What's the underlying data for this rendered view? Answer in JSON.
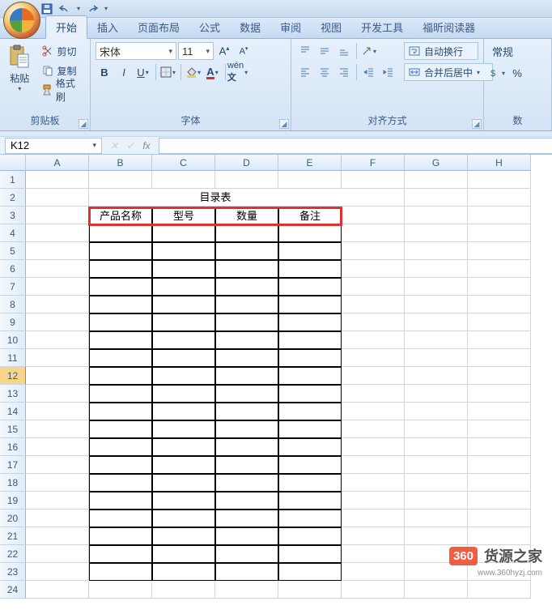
{
  "qat": {
    "save_icon": "save-icon",
    "undo_icon": "undo-icon",
    "redo_icon": "redo-icon"
  },
  "tabs": {
    "items": [
      "开始",
      "插入",
      "页面布局",
      "公式",
      "数据",
      "审阅",
      "视图",
      "开发工具",
      "福昕阅读器"
    ],
    "active_index": 0
  },
  "ribbon": {
    "clipboard": {
      "paste_label": "粘贴",
      "cut_label": "剪切",
      "copy_label": "复制",
      "format_painter_label": "格式刷",
      "group_label": "剪贴板"
    },
    "font": {
      "name": "宋体",
      "size": "11",
      "group_label": "字体",
      "bold": "B",
      "italic": "I",
      "underline": "U"
    },
    "align": {
      "wrap_label": "自动换行",
      "merge_label": "合并后居中",
      "group_label": "对齐方式"
    },
    "number": {
      "format_label": "常规",
      "percent": "%",
      "group_label": "数"
    }
  },
  "formula_bar": {
    "name_box": "K12",
    "fx_label": "fx",
    "formula_value": ""
  },
  "grid": {
    "columns": [
      "A",
      "B",
      "C",
      "D",
      "E",
      "F",
      "G",
      "H"
    ],
    "row_count": 24,
    "active_row": 12,
    "content": {
      "title_row": 2,
      "title_text": "目录表",
      "header_row": 3,
      "headers": [
        "产品名称",
        "型号",
        "数量",
        "备注"
      ],
      "header_cols": [
        "B",
        "C",
        "D",
        "E"
      ],
      "body_rows": [
        4,
        5,
        6,
        7,
        8,
        9,
        10,
        11,
        12,
        13,
        14,
        15,
        16,
        17,
        18,
        19,
        20,
        21,
        22,
        23
      ]
    }
  },
  "watermark": {
    "badge": "360",
    "text": "货源之家",
    "sub": "www.360hyzj.com"
  }
}
